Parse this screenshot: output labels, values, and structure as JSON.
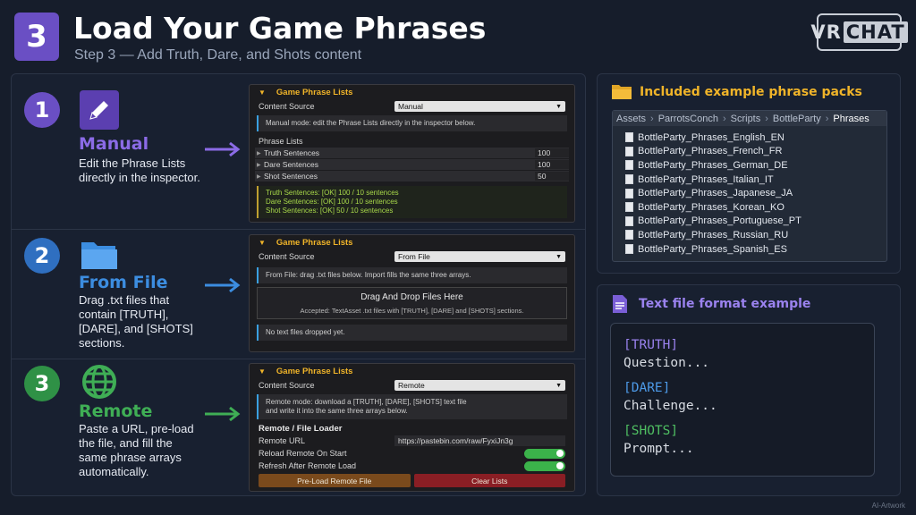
{
  "header": {
    "step": "3",
    "title": "Load Your Game Phrases",
    "subtitle": "Step 3 — Add Truth, Dare, and Shots content",
    "logo_left": "VR",
    "logo_right": "CHAT"
  },
  "colors": {
    "purple": "#8b6be6",
    "blue": "#3c8de0",
    "green": "#3fae55",
    "accent_yellow": "#f0b429"
  },
  "modes": [
    {
      "num": "1",
      "icon": "pencil-icon",
      "title": "Manual",
      "desc": "Edit the Phrase Lists directly in the inspector.",
      "inspector": {
        "header": "Game Phrase Lists",
        "content_source_label": "Content Source",
        "content_source_value": "Manual",
        "note": "Manual mode: edit the Phrase Lists directly in the inspector below.",
        "list_header": "Phrase Lists",
        "lists": [
          {
            "label": "Truth Sentences",
            "value": "100"
          },
          {
            "label": "Dare Sentences",
            "value": "100"
          },
          {
            "label": "Shot Sentences",
            "value": "50"
          }
        ],
        "status": [
          "Truth Sentences: [OK] 100 / 10 sentences",
          "Dare Sentences: [OK] 100 / 10 sentences",
          "Shot Sentences: [OK] 50 / 10 sentences"
        ]
      }
    },
    {
      "num": "2",
      "icon": "folder-icon",
      "title": "From File",
      "desc": "Drag .txt files that contain [TRUTH], [DARE], and [SHOTS] sections.",
      "inspector": {
        "header": "Game Phrase Lists",
        "content_source_label": "Content Source",
        "content_source_value": "From File",
        "note": "From File: drag .txt files below. Import fills the same three arrays.",
        "drop_title": "Drag And Drop Files Here",
        "drop_sub": "Accepted: TextAsset .txt files with [TRUTH], [DARE] and [SHOTS] sections.",
        "footer_note": "No text files dropped yet."
      }
    },
    {
      "num": "3",
      "icon": "globe-icon",
      "title": "Remote",
      "desc": "Paste a URL, pre-load the file, and fill the same phrase arrays automatically.",
      "inspector": {
        "header": "Game Phrase Lists",
        "content_source_label": "Content Source",
        "content_source_value": "Remote",
        "note_line1": "Remote mode: download a [TRUTH], [DARE], [SHOTS] text file",
        "note_line2": "and write it into the same three arrays below.",
        "section": "Remote / File Loader",
        "url_label": "Remote URL",
        "url_value": "https://pastebin.com/raw/FyxiJn3g",
        "reload_label": "Reload Remote On Start",
        "refresh_label": "Refresh After Remote Load",
        "preload_button": "Pre-Load Remote File",
        "clear_button": "Clear Lists"
      }
    }
  ],
  "packs": {
    "title": "Included example phrase packs",
    "breadcrumb": [
      "Assets",
      "ParrotsConch",
      "Scripts",
      "BottleParty",
      "Phrases"
    ],
    "files": [
      "BottleParty_Phrases_English_EN",
      "BottleParty_Phrases_French_FR",
      "BottleParty_Phrases_German_DE",
      "BottleParty_Phrases_Italian_IT",
      "BottleParty_Phrases_Japanese_JA",
      "BottleParty_Phrases_Korean_KO",
      "BottleParty_Phrases_Portuguese_PT",
      "BottleParty_Phrases_Russian_RU",
      "BottleParty_Phrases_Spanish_ES"
    ]
  },
  "format": {
    "title": "Text file format example",
    "truth_tag": "[TRUTH]",
    "truth_text": "Question...",
    "dare_tag": "[DARE]",
    "dare_text": "Challenge...",
    "shots_tag": "[SHOTS]",
    "shots_text": "Prompt..."
  },
  "watermark": "AI-Artwork"
}
